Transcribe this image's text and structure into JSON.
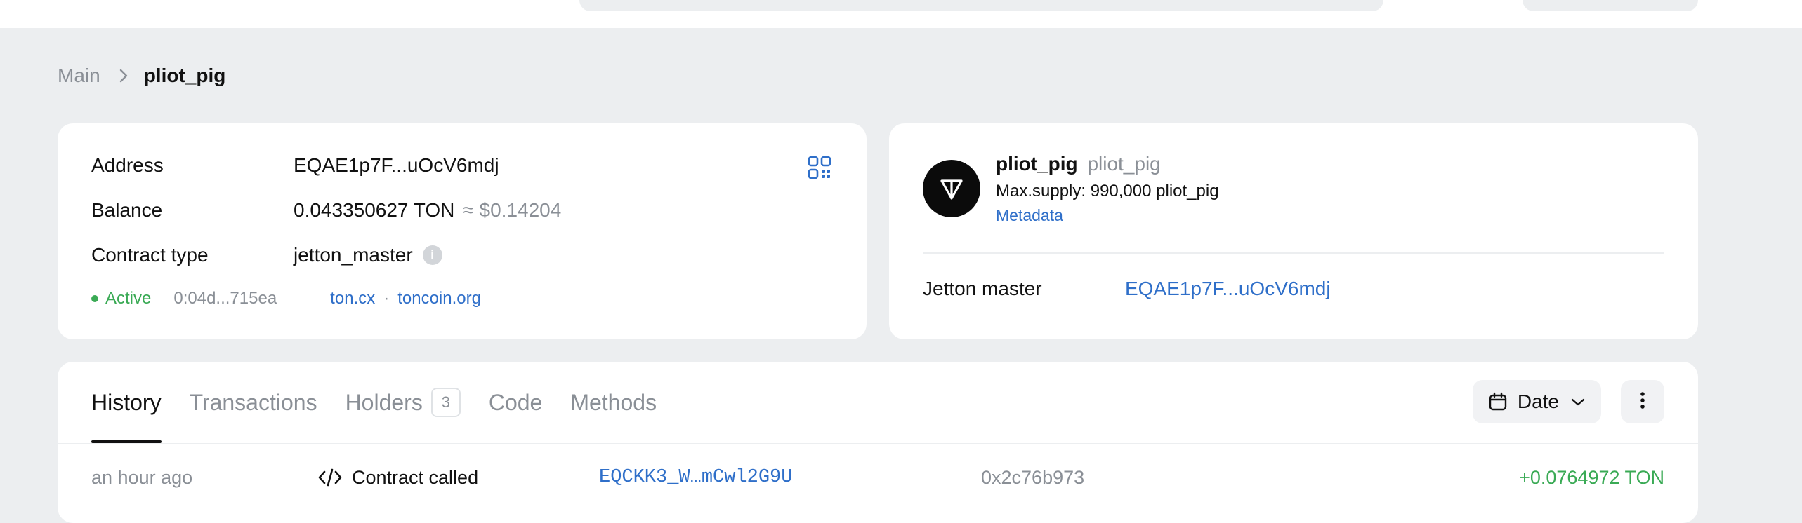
{
  "breadcrumb": {
    "main": "Main",
    "current": "pliot_pig"
  },
  "account": {
    "address_label": "Address",
    "address_value": "EQAE1p7F...uOcV6mdj",
    "balance_label": "Balance",
    "balance_value": "0.043350627 TON",
    "balance_fiat": "≈ $0.14204",
    "contract_type_label": "Contract type",
    "contract_type_value": "jetton_master",
    "status": "Active",
    "code_hash": "0:04d...715ea",
    "links": [
      "ton.cx",
      "toncoin.org"
    ],
    "link_separator": "·"
  },
  "jetton": {
    "name": "pliot_pig",
    "symbol": "pliot_pig",
    "max_supply": "Max.supply: 990,000 pliot_pig",
    "metadata_label": "Metadata",
    "master_label": "Jetton master",
    "master_value": "EQAE1p7F...uOcV6mdj"
  },
  "tabs": [
    {
      "label": "History",
      "active": true
    },
    {
      "label": "Transactions",
      "active": false
    },
    {
      "label": "Holders",
      "count": "3",
      "active": false
    },
    {
      "label": "Code",
      "active": false
    },
    {
      "label": "Methods",
      "active": false
    }
  ],
  "filters": {
    "date_label": "Date"
  },
  "transactions": [
    {
      "time": "an hour ago",
      "action": "Contract called",
      "address": "EQCKK3_W…mCwl2G9U",
      "op": "0x2c76b973",
      "amount": "+0.0764972 TON"
    }
  ],
  "colors": {
    "accent_link": "#2f6fc9",
    "positive": "#3aaa55",
    "muted": "#8a8f96",
    "background": "#eceef0"
  },
  "icons": {
    "breadcrumb_separator": "chevron-right-icon",
    "qr": "qr-code-icon",
    "info": "info-icon",
    "token": "ton-logo-icon",
    "calendar": "calendar-icon",
    "dropdown": "chevron-down-icon",
    "more": "more-vertical-icon",
    "contract": "code-icon"
  }
}
